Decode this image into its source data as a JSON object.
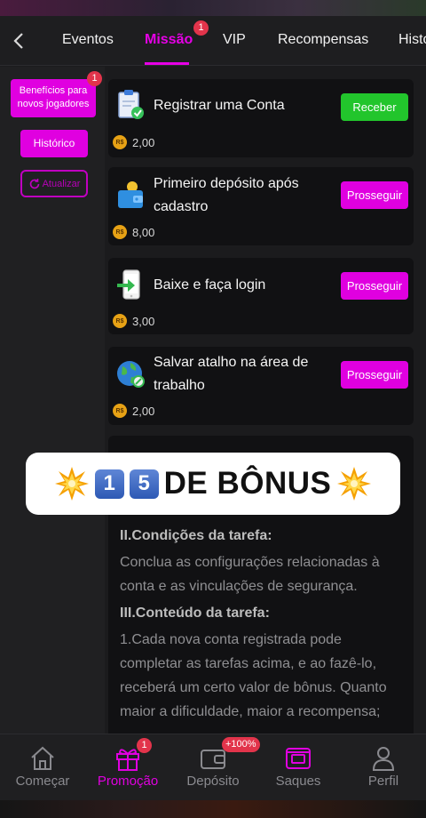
{
  "nav": {
    "tabs": [
      {
        "label": "Eventos"
      },
      {
        "label": "Missão",
        "badge": "1"
      },
      {
        "label": "VIP"
      },
      {
        "label": "Recompensas"
      },
      {
        "label": "Histo"
      }
    ]
  },
  "sidebar": {
    "benefits_label": "Benefícios para novos jogadores",
    "benefits_badge": "1",
    "history_label": "Histórico",
    "refresh_label": "Atualizar"
  },
  "tasks": [
    {
      "title": "Registrar uma Conta",
      "reward": "2,00",
      "button": "Receber",
      "icon": "clipboard-check-icon"
    },
    {
      "title": "Primeiro depósito após cadastro",
      "reward": "8,00",
      "button": "Prosseguir",
      "icon": "wallet-icon"
    },
    {
      "title": "Baixe e faça login",
      "reward": "3,00",
      "button": "Prosseguir",
      "icon": "phone-login-icon"
    },
    {
      "title": "Salvar atalho na área de trabalho",
      "reward": "2,00",
      "button": "Prosseguir",
      "icon": "globe-link-icon"
    }
  ],
  "currency": "R$",
  "info": {
    "conditions_heading": "II.Condições da tarefa:",
    "conditions_text": "Conclua as configurações relacionadas à conta e as vinculações de segurança.",
    "content_heading": "III.Conteúdo da tarefa:",
    "content_text": "1.Cada nova conta registrada pode completar as tarefas acima, e ao fazê-lo, receberá um certo valor de bônus. Quanto maior a dificuldade, maior a recompensa;"
  },
  "banner": {
    "digits": [
      "1",
      "5"
    ],
    "text": "DE BÔNUS"
  },
  "bottom_nav": [
    {
      "label": "Começar",
      "icon": "home-icon"
    },
    {
      "label": "Promoção",
      "icon": "gift-icon",
      "badge": "1"
    },
    {
      "label": "Depósito",
      "icon": "wallet-icon",
      "badge": "+100%"
    },
    {
      "label": "Saques",
      "icon": "withdraw-icon"
    },
    {
      "label": "Perfil",
      "icon": "user-icon"
    }
  ],
  "colors": {
    "accent": "#e000e0",
    "green": "#22c52c",
    "badge": "#e2344b"
  }
}
